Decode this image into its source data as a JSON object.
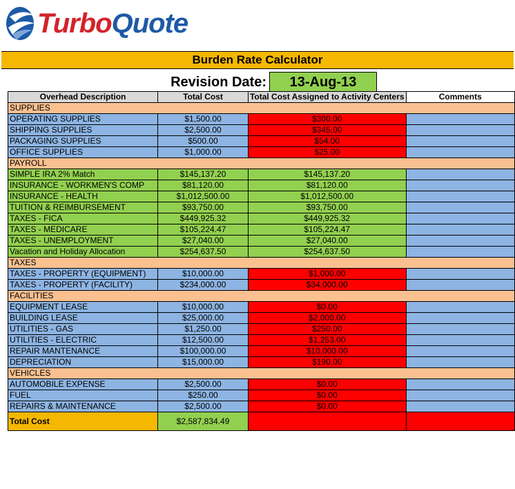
{
  "logo": {
    "turbo": "Turbo",
    "quote": "Quote"
  },
  "title": "Burden Rate Calculator",
  "revision": {
    "label": "Revision Date:",
    "date": "13-Aug-13"
  },
  "headers": {
    "description": "Overhead  Description",
    "total_cost": "Total Cost",
    "assigned": "Total Cost Assigned to Activity Centers",
    "comments": "Comments"
  },
  "sections": [
    {
      "name": "SUPPLIES",
      "rows": [
        {
          "desc": "OPERATING SUPPLIES",
          "cost": "$1,500.00",
          "assigned": "$300.00",
          "style": "blue",
          "assigned_red": true
        },
        {
          "desc": "SHIPPING SUPPLIES",
          "cost": "$2,500.00",
          "assigned": "$345.00",
          "style": "blue",
          "assigned_red": true
        },
        {
          "desc": "PACKAGING SUPPLIES",
          "cost": "$500.00",
          "assigned": "$54.00",
          "style": "blue",
          "assigned_red": true
        },
        {
          "desc": "OFFICE SUPPLIES",
          "cost": "$1,000.00",
          "assigned": "$25.00",
          "style": "blue",
          "assigned_red": true
        }
      ]
    },
    {
      "name": "PAYROLL",
      "rows": [
        {
          "desc": "SIMPLE IRA 2% Match",
          "cost": "$145,137.20",
          "assigned": "$145,137.20",
          "style": "green",
          "assigned_red": false
        },
        {
          "desc": "INSURANCE - WORKMEN'S COMP",
          "cost": "$81,120.00",
          "assigned": "$81,120.00",
          "style": "green",
          "assigned_red": false
        },
        {
          "desc": "INSURANCE - HEALTH",
          "cost": "$1,012,500.00",
          "assigned": "$1,012,500.00",
          "style": "green",
          "assigned_red": false
        },
        {
          "desc": "TUITION & REIMBURSEMENT",
          "cost": "$93,750.00",
          "assigned": "$93,750.00",
          "style": "green",
          "assigned_red": false
        },
        {
          "desc": "TAXES - FICA",
          "cost": "$449,925.32",
          "assigned": "$449,925.32",
          "style": "green",
          "assigned_red": false
        },
        {
          "desc": "TAXES - MEDICARE",
          "cost": "$105,224.47",
          "assigned": "$105,224.47",
          "style": "green",
          "assigned_red": false
        },
        {
          "desc": "TAXES - UNEMPLOYMENT",
          "cost": "$27,040.00",
          "assigned": "$27,040.00",
          "style": "green",
          "assigned_red": false
        },
        {
          "desc": "Vacation and Holiday Allocation",
          "cost": "$254,637.50",
          "assigned": "$254,637.50",
          "style": "green",
          "assigned_red": false
        }
      ]
    },
    {
      "name": "TAXES",
      "rows": [
        {
          "desc": "TAXES - PROPERTY (EQUIPMENT)",
          "cost": "$10,000.00",
          "assigned": "$1,000.00",
          "style": "blue",
          "assigned_red": true
        },
        {
          "desc": "TAXES - PROPERTY (FACILITY)",
          "cost": "$234,000.00",
          "assigned": "$34,000.00",
          "style": "blue",
          "assigned_red": true
        }
      ]
    },
    {
      "name": "FACILITIES",
      "rows": [
        {
          "desc": "EQUIPMENT LEASE",
          "cost": "$10,000.00",
          "assigned": "$0.00",
          "style": "blue",
          "assigned_red": true
        },
        {
          "desc": "BUILDING LEASE",
          "cost": "$25,000.00",
          "assigned": "$2,000.00",
          "style": "blue",
          "assigned_red": true
        },
        {
          "desc": "UTILITIES - GAS",
          "cost": "$1,250.00",
          "assigned": "$250.00",
          "style": "blue",
          "assigned_red": true
        },
        {
          "desc": "UTILITIES - ELECTRIC",
          "cost": "$12,500.00",
          "assigned": "$1,253.00",
          "style": "blue",
          "assigned_red": true
        },
        {
          "desc": "REPAIR MANTENANCE",
          "cost": "$100,000.00",
          "assigned": "$10,000.00",
          "style": "blue",
          "assigned_red": true
        },
        {
          "desc": "DEPRECIATION",
          "cost": "$15,000.00",
          "assigned": "$190.00",
          "style": "blue",
          "assigned_red": true
        }
      ]
    },
    {
      "name": "VEHICLES",
      "rows": [
        {
          "desc": "AUTOMOBILE EXPENSE",
          "cost": "$2,500.00",
          "assigned": "$0.00",
          "style": "blue",
          "assigned_red": true
        },
        {
          "desc": "FUEL",
          "cost": "$250.00",
          "assigned": "$0.00",
          "style": "blue",
          "assigned_red": true
        },
        {
          "desc": "REPAIRS & MAINTENANCE",
          "cost": "$2,500.00",
          "assigned": "$0.00",
          "style": "blue",
          "assigned_red": true
        }
      ]
    }
  ],
  "total": {
    "label": "Total Cost",
    "value": "$2,587,834.49"
  },
  "colors": {
    "title_bar": "#f5b800",
    "blue_row": "#8db4e2",
    "green_row": "#92d050",
    "section_row": "#fac090",
    "red_cell": "#ff0000",
    "logo_red": "#d3232b",
    "logo_blue": "#1d5aa8"
  }
}
